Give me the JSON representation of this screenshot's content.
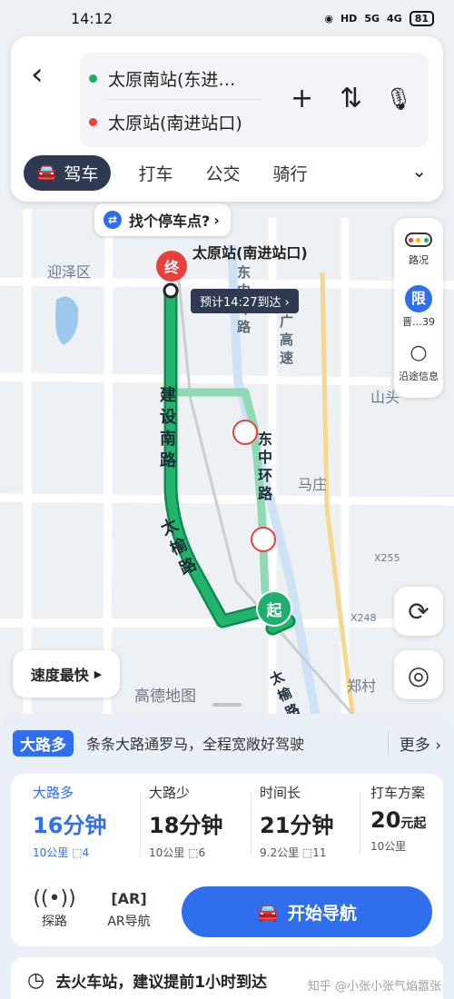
{
  "status_bar": {
    "time": "14:12",
    "signal1": "5G",
    "signal2": "4G",
    "battery": "81",
    "hd": "HD"
  },
  "header": {
    "back_icon": "back-arrow-icon",
    "origin": "太原南站(东进…",
    "destination": "太原站(南进站口)",
    "colors": {
      "origin_dot": "#1fae6b",
      "dest_dot": "#e8403e"
    }
  },
  "modes": [
    {
      "label": "驾车",
      "active": true
    },
    {
      "label": "打车",
      "active": false
    },
    {
      "label": "公交",
      "active": false
    },
    {
      "label": "骑行",
      "active": false
    }
  ],
  "map": {
    "parking_prompt": "找个停车点?",
    "dest_label": "太原站(南进站口)",
    "eta": "预计14:27到达",
    "end_marker": "终",
    "start_marker": "起",
    "labels": {
      "district": "迎泽区",
      "east_ring": "东中环路",
      "east_ring_upper": "东中环路",
      "expressway": "广高速",
      "mountain": "山头",
      "village": "马庄",
      "x255": "X255",
      "x248": "X248",
      "zheng_village": "郑村",
      "road_main": "建设南路",
      "road_taiyu": "太榆路",
      "road_taiyu2": "太榆路"
    },
    "right_controls": {
      "traffic": "路况",
      "limit": "限",
      "limit_sub": "晋…39",
      "along": "沿途信息"
    },
    "speed_pref": "速度最快",
    "logo": "高德地图"
  },
  "sheet": {
    "tag": "大路多",
    "tip": "条条大路通罗马，全程宽敞好驾驶",
    "more": "更多",
    "plans": [
      {
        "name": "大路多",
        "time": "16分钟",
        "dist": "10公里",
        "lights": "4",
        "active": true
      },
      {
        "name": "大路少",
        "time": "18分钟",
        "dist": "10公里",
        "lights": "6",
        "active": false
      },
      {
        "name": "时间长",
        "time": "21分钟",
        "dist": "9.2公里",
        "lights": "11",
        "active": false
      },
      {
        "name": "打车方案",
        "price": "20",
        "price_unit": "元起",
        "dist": "10公里",
        "active": false
      }
    ],
    "tools": [
      {
        "label": "探路",
        "icon": "explore-icon"
      },
      {
        "label": "AR导航",
        "icon": "ar-icon"
      }
    ],
    "start_nav": "开始导航",
    "train_tip": "去火车站，建议提前1小时到达",
    "watermark": "知乎 @小张小张气焰嚣张"
  }
}
